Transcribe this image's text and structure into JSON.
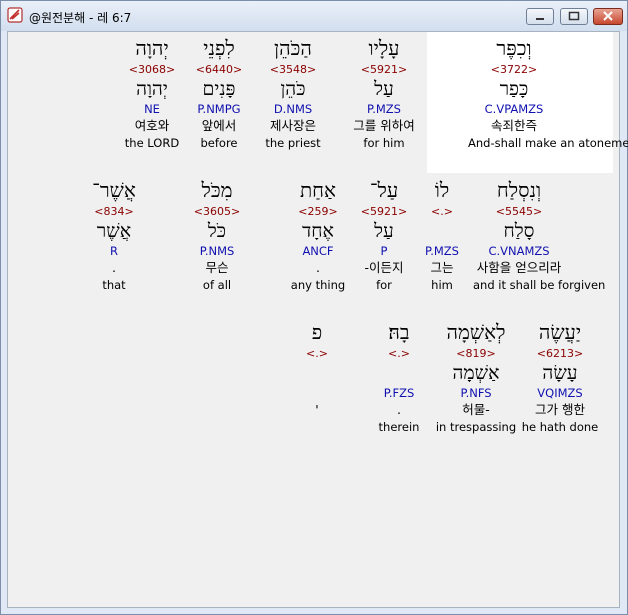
{
  "window": {
    "title": "@원전분해 - 레 6:7"
  },
  "rows": [
    {
      "words": [
        {
          "hebrew": "וְכִפֶּר",
          "code": "<3722>",
          "lemma": "כָּפַר",
          "parsing": "C.VPAMZS",
          "korean": "속죄한즉",
          "english": "And-shall make an atonement"
        },
        {
          "hebrew": "עָלָיו",
          "code": "<5921>",
          "lemma": "עַל",
          "parsing": "P.MZS",
          "korean": "그를 위하여",
          "english": "for him"
        },
        {
          "hebrew": "הַכֹּהֵן",
          "code": "<3548>",
          "lemma": "כֹּהֵן",
          "parsing": "D.NMS",
          "korean": "제사장은",
          "english": "the priest"
        },
        {
          "hebrew": "לִפְנֵי",
          "code": "<6440>",
          "lemma": "פָּנִים",
          "parsing": "P.NMPG",
          "korean": "앞에서",
          "english": "before"
        },
        {
          "hebrew": "יְהוָה",
          "code": "<3068>",
          "lemma": "יְהוָה",
          "parsing": "NE",
          "korean": "여호와",
          "english": "the LORD"
        }
      ]
    },
    {
      "words": [
        {
          "hebrew": "וְנִסְלַח",
          "code": "<5545>",
          "lemma": "סָלַח",
          "parsing": "C.VNAMZS",
          "korean": "사함을 얻으리라",
          "english": "and it shall be forgiven"
        },
        {
          "hebrew": "לוֹ",
          "code": "<.>",
          "lemma": "",
          "parsing": "P.MZS",
          "korean": "그는",
          "english": "him"
        },
        {
          "hebrew": "עַל־",
          "code": "<5921>",
          "lemma": "עַל",
          "parsing": "P",
          "korean": "-이든지",
          "english": "for"
        },
        {
          "hebrew": "אַחַת",
          "code": "<259>",
          "lemma": "אֶחָד",
          "parsing": "ANCF",
          "korean": ".",
          "english": "any thing"
        },
        {
          "hebrew": "מִכֹּל",
          "code": "<3605>",
          "lemma": "כֹּל",
          "parsing": "P.NMS",
          "korean": "무슨",
          "english": "of all"
        },
        {
          "hebrew": "אֲשֶׁר־",
          "code": "<834>",
          "lemma": "אֲשֶׁר",
          "parsing": "R",
          "korean": ".",
          "english": "that"
        }
      ]
    },
    {
      "words": [
        {
          "hebrew": "יַעֲשֶׂה",
          "code": "<6213>",
          "lemma": "עָשָׂה",
          "parsing": "VQIMZS",
          "korean": "그가 행한",
          "english": "he hath done"
        },
        {
          "hebrew": "לְאַשְׁמָה",
          "code": "<819>",
          "lemma": "אַשְׁמָה",
          "parsing": "P.NFS",
          "korean": "허물-",
          "english": "in trespassing"
        },
        {
          "hebrew": "בָהּ׃",
          "code": "<.>",
          "lemma": "",
          "parsing": "P.FZS",
          "korean": ".",
          "english": "therein"
        },
        {
          "hebrew": "פ",
          "code": "<.>",
          "lemma": "",
          "parsing": "",
          "korean": "'",
          "english": ""
        }
      ]
    }
  ]
}
